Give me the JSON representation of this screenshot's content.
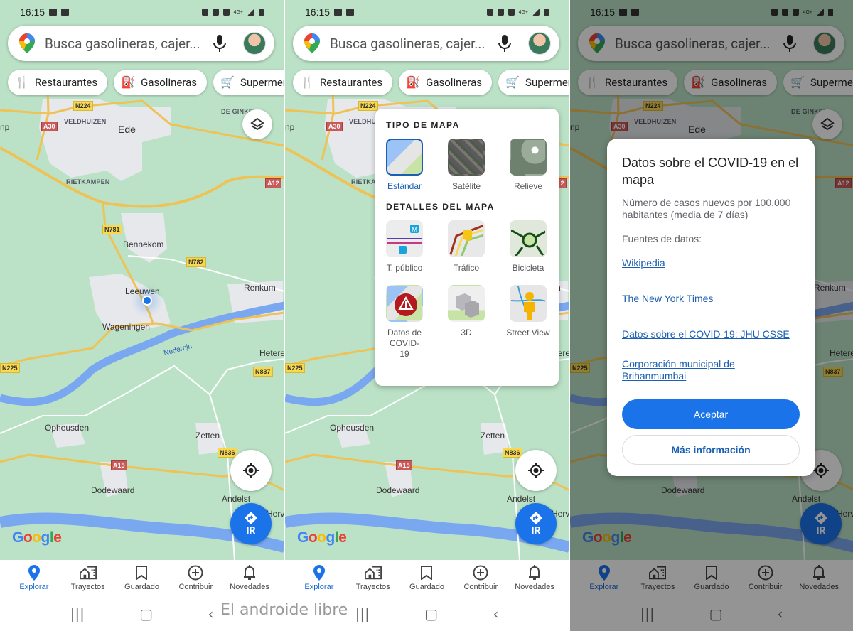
{
  "status_bar": {
    "time": "16:15"
  },
  "search": {
    "placeholder": "Busca gasolineras, cajer..."
  },
  "chips": [
    "Restaurantes",
    "Gasolineras",
    "Supermercados"
  ],
  "map_labels": {
    "cities": [
      "Ede",
      "Bennekom",
      "Leeuwen",
      "Wageningen",
      "Renkum",
      "Opheusden",
      "Zetten",
      "Dodewaard",
      "Andelst",
      "Hetere",
      "Herv"
    ],
    "districts": [
      "VELDHUIZEN",
      "RIETKAMPEN",
      "DE GINKEL"
    ],
    "roads": [
      "N224",
      "A30",
      "A12",
      "N781",
      "N782",
      "N225",
      "N837",
      "N836",
      "A15"
    ],
    "river": "Nederrijn",
    "partial": "np"
  },
  "google_logo": "Google",
  "go_button": "IR",
  "bottom_nav": [
    {
      "label": "Explorar",
      "icon": "explore-pin-icon",
      "active": true
    },
    {
      "label": "Trayectos",
      "icon": "commute-icon",
      "active": false
    },
    {
      "label": "Guardado",
      "icon": "bookmark-icon",
      "active": false
    },
    {
      "label": "Contribuir",
      "icon": "add-circle-icon",
      "active": false
    },
    {
      "label": "Novedades",
      "icon": "bell-icon",
      "active": false
    }
  ],
  "layers_sheet": {
    "map_type_title": "TIPO DE MAPA",
    "map_types": [
      {
        "label": "Estándar",
        "selected": true
      },
      {
        "label": "Satélite",
        "selected": false
      },
      {
        "label": "Relieve",
        "selected": false
      }
    ],
    "details_title": "DETALLES DEL MAPA",
    "details": [
      {
        "label": "T. público"
      },
      {
        "label": "Tráfico"
      },
      {
        "label": "Bicicleta"
      },
      {
        "label": "Datos de COVID-19"
      },
      {
        "label": "3D"
      },
      {
        "label": "Street View"
      }
    ]
  },
  "covid_dialog": {
    "title": "Datos sobre el COVID-19 en el mapa",
    "description": "Número de casos nuevos por 100.000 habitantes (media de 7 días)",
    "sources_label": "Fuentes de datos:",
    "links": [
      "Wikipedia",
      "The New York Times",
      "Datos sobre el COVID-19: JHU CSSE",
      "Corporación municipal de Brihanmumbai"
    ],
    "accept": "Aceptar",
    "more_info": "Más información"
  },
  "watermark": "El androide libre",
  "colors": {
    "accent": "#1a73e8",
    "map_green": "#bbe2c6",
    "river": "#7aa8f0",
    "road": "#f4d878",
    "urban": "#e6e8ec"
  }
}
